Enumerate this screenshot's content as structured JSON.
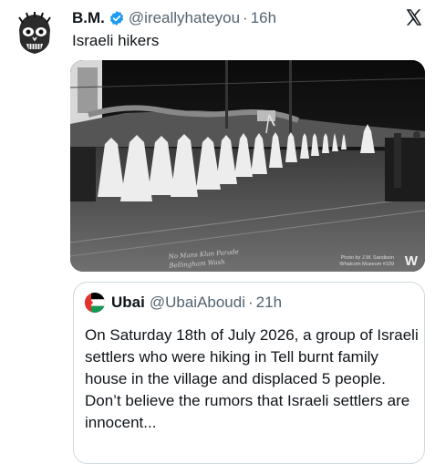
{
  "author": {
    "name": "B.M.",
    "handle": "@ireallyhateyou",
    "separator": "·",
    "time": "16h",
    "avatar_icon": "skull-avatar-icon",
    "verified_icon": "verified-badge-icon",
    "verified_color": "#1d9bf0"
  },
  "tweet": {
    "text": "Israeli hikers"
  },
  "media": {
    "caption_line1": "No Mans Klan Parade",
    "caption_line2": "Bellingham Wash",
    "credit_line1": "Photo by J.W. Sandison",
    "credit_line2": "Whatcom Museum #109",
    "logo": "W"
  },
  "quoted": {
    "name": "Ubai",
    "handle": "@UbaiAboudi",
    "separator": "·",
    "time": "21h",
    "text": "On Saturday 18th of July 2026, a group of Israeli settlers who were hiking in Tell burnt family house in the village and displaced 5 people. Don’t believe the rumors that Israeli settlers are innocent..."
  },
  "colors": {
    "text": "#0f1419",
    "secondary": "#536471",
    "border": "#cfd9de"
  }
}
